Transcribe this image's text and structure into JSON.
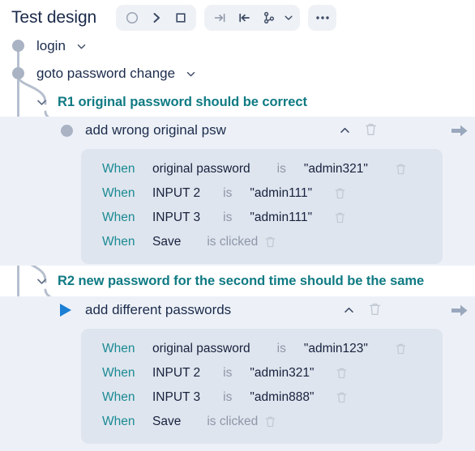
{
  "header": {
    "title": "Test design",
    "toolbar": {
      "group1": [
        {
          "name": "record-circle-icon",
          "label": "Record"
        },
        {
          "name": "play-chevron-icon",
          "label": "Run"
        },
        {
          "name": "stop-square-icon",
          "label": "Stop"
        }
      ],
      "group2": [
        {
          "name": "step-into-icon",
          "label": "Step into"
        },
        {
          "name": "step-back-icon",
          "label": "Step back"
        },
        {
          "name": "branch-icon",
          "label": "Branch"
        },
        {
          "name": "chevron-down-icon",
          "label": "Branch options"
        }
      ],
      "group3": [
        {
          "name": "more-options-icon",
          "label": "More"
        }
      ]
    }
  },
  "tree": {
    "nodes": [
      {
        "label": "login",
        "caret": "chevron-down-icon"
      },
      {
        "label": "goto password change",
        "caret": "chevron-down-icon"
      }
    ],
    "rules": [
      {
        "id": "R1",
        "title": "R1 original password should be correct",
        "chevron": "chevron-down-icon",
        "cases": [
          {
            "title": "add wrong original psw",
            "marker": "dot",
            "collapse_icon": "chevron-up-icon",
            "delete_icon": "trash-icon",
            "run_icon": "arrow-right-icon",
            "steps": [
              {
                "keyword": "When",
                "target": "original password",
                "op": "is",
                "value": "\"admin321\"",
                "delete_icon": "trash-icon"
              },
              {
                "keyword": "When",
                "target": "INPUT 2",
                "op": "is",
                "value": "\"admin111\"",
                "delete_icon": "trash-icon"
              },
              {
                "keyword": "When",
                "target": "INPUT 3",
                "op": "is",
                "value": "\"admin111\"",
                "delete_icon": "trash-icon"
              },
              {
                "keyword": "When",
                "target": "Save",
                "op": "is clicked",
                "value": "",
                "delete_icon": "trash-icon"
              }
            ]
          }
        ]
      },
      {
        "id": "R2",
        "title": "R2 new password for the second time should be the same",
        "chevron": "chevron-down-icon",
        "cases": [
          {
            "title": "add different passwords",
            "marker": "play",
            "collapse_icon": "chevron-up-icon",
            "delete_icon": "trash-icon",
            "run_icon": "arrow-right-icon",
            "steps": [
              {
                "keyword": "When",
                "target": "original password",
                "op": "is",
                "value": "\"admin123\"",
                "delete_icon": "trash-icon"
              },
              {
                "keyword": "When",
                "target": "INPUT 2",
                "op": "is",
                "value": "\"admin321\"",
                "delete_icon": "trash-icon"
              },
              {
                "keyword": "When",
                "target": "INPUT 3",
                "op": "is",
                "value": "\"admin888\"",
                "delete_icon": "trash-icon"
              },
              {
                "keyword": "When",
                "target": "Save",
                "op": "is clicked",
                "value": "",
                "delete_icon": "trash-icon"
              }
            ]
          }
        ]
      }
    ]
  },
  "colors": {
    "rule_teal": "#0f7a83",
    "keyword_teal": "#1a8a93",
    "title_navy": "#1b2b4b",
    "band_bg": "#edf1f7",
    "panel_bg": "#dfe5ee",
    "connector": "#b6bfce",
    "play_blue": "#1b7fd4",
    "muted": "#8d97a8"
  }
}
